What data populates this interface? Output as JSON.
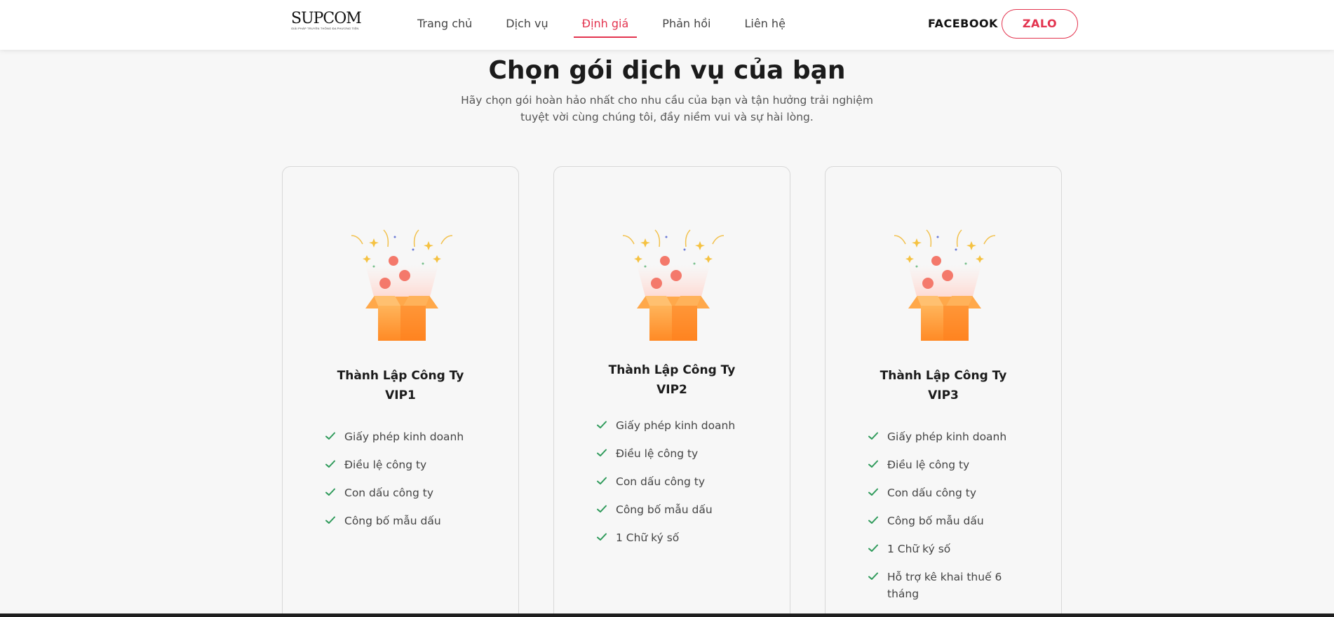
{
  "header": {
    "logo_main": "SUPCOM",
    "logo_sub": "GIẢI PHÁP TRUYỀN THÔNG ĐA PHƯƠNG TIỆN",
    "nav": [
      {
        "label": "Trang chủ",
        "active": false
      },
      {
        "label": "Dịch vụ",
        "active": false
      },
      {
        "label": "Định giá",
        "active": true
      },
      {
        "label": "Phản hồi",
        "active": false
      },
      {
        "label": "Liên hệ",
        "active": false
      }
    ],
    "facebook_label": "FACEBOOK",
    "zalo_label": "ZALO"
  },
  "hero": {
    "title": "Chọn gói dịch vụ của bạn",
    "subtitle_line1": "Hãy chọn gói hoàn hảo nhất cho nhu cầu của bạn và tận hưởng trải nghiệm",
    "subtitle_line2": "tuyệt vời cùng chúng tôi, đầy niềm vui và sự hài lòng."
  },
  "colors": {
    "accent": "#e3344f",
    "check": "#2e9a5a",
    "box_orange": "#ff8c2a"
  },
  "plans": [
    {
      "title_line1": "Thành Lập Công Ty",
      "title_line2": "VIP1",
      "icon": "gift-box-icon",
      "features": [
        "Giấy phép kinh doanh",
        "Điều lệ công ty",
        "Con dấu công ty",
        "Công bố mẫu dấu"
      ]
    },
    {
      "title_line1": "Thành Lập Công Ty",
      "title_line2": "VIP2",
      "icon": "gift-box-icon",
      "features": [
        "Giấy phép kinh doanh",
        "Điều lệ công ty",
        "Con dấu công ty",
        "Công bố mẫu dấu",
        "1 Chữ ký số"
      ]
    },
    {
      "title_line1": "Thành Lập Công Ty",
      "title_line2": "VIP3",
      "icon": "gift-box-icon",
      "features": [
        "Giấy phép kinh doanh",
        "Điều lệ công ty",
        "Con dấu công ty",
        "Công bố mẫu dấu",
        "1 Chữ ký số",
        "Hỗ trợ kê khai thuế 6 tháng"
      ]
    }
  ]
}
